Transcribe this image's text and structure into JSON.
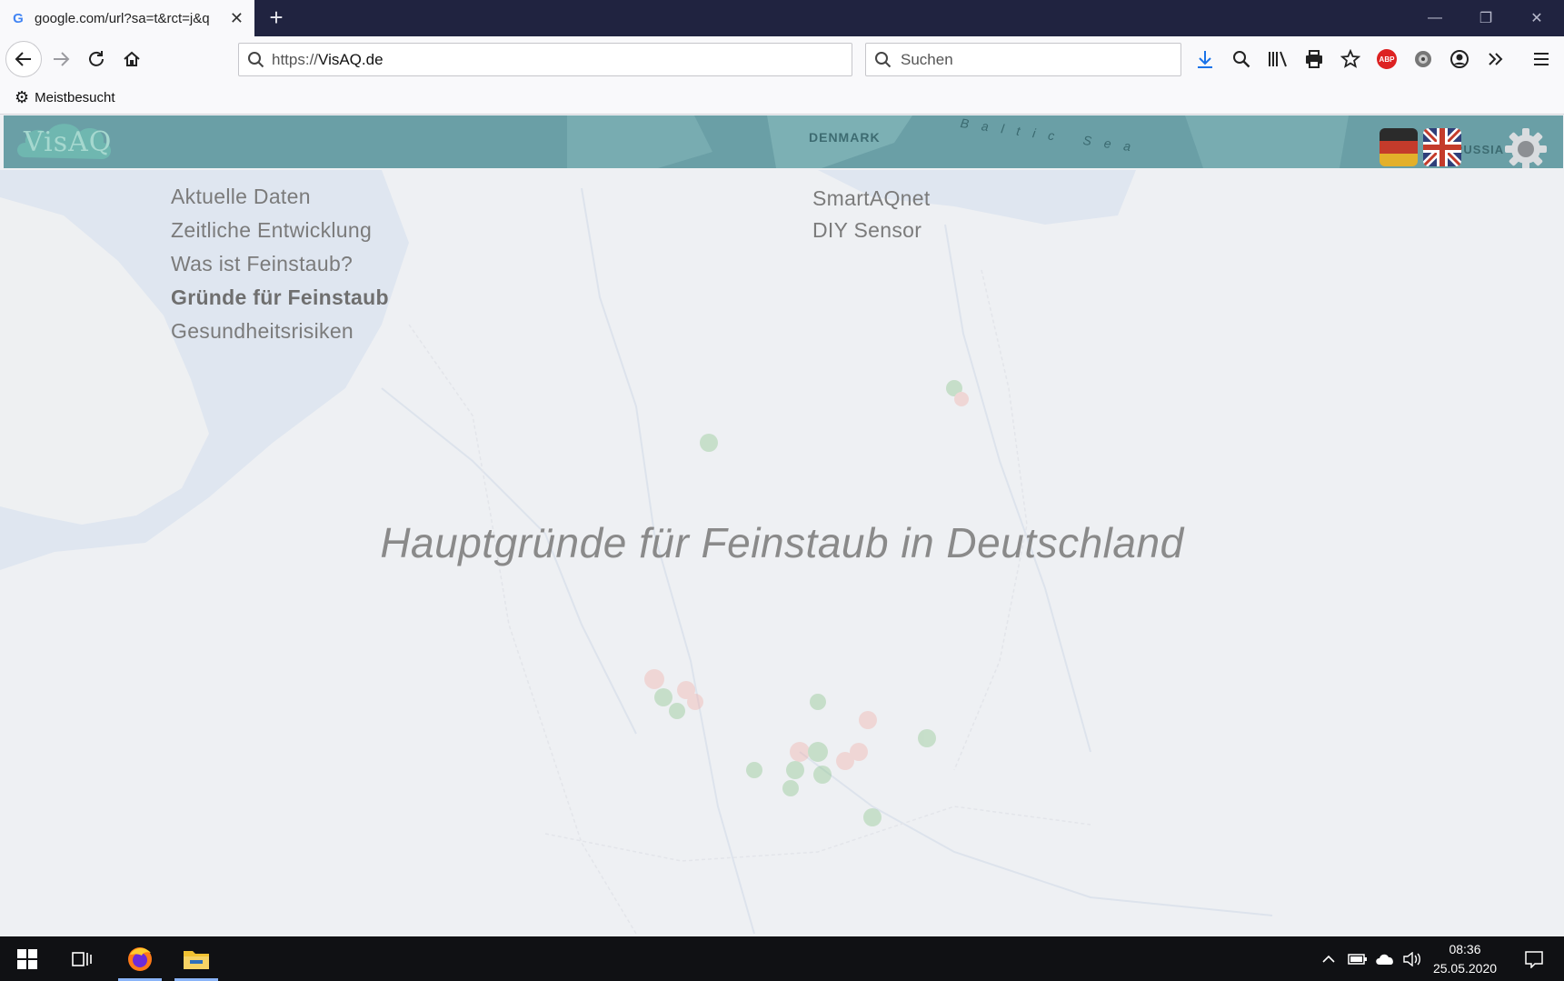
{
  "browser": {
    "tab": {
      "title": "google.com/url?sa=t&rct=j&q",
      "favicon": "G"
    },
    "new_tab_label": "+",
    "url": {
      "prefix": "https://",
      "host": "VisAQ.de"
    },
    "search_placeholder": "Suchen",
    "bookmarks": [
      {
        "label": "Meistbesucht",
        "icon": "gear-icon"
      }
    ]
  },
  "site": {
    "logo_text": "VisAQ",
    "header_labels": [
      "DENMARK",
      "Baltic Sea",
      "RUSSIA"
    ],
    "languages": [
      {
        "code": "de",
        "icon": "german-flag-icon"
      },
      {
        "code": "en",
        "icon": "uk-flag-icon"
      }
    ],
    "menu_left": [
      {
        "label": "Aktuelle Daten",
        "active": false
      },
      {
        "label": "Zeitliche Entwicklung",
        "active": false
      },
      {
        "label": "Was ist Feinstaub?",
        "active": false
      },
      {
        "label": "Gründe für Feinstaub",
        "active": true
      },
      {
        "label": "Gesundheitsrisiken",
        "active": false
      }
    ],
    "menu_right": [
      {
        "label": "SmartAQnet"
      },
      {
        "label": "DIY Sensor"
      }
    ],
    "hero_title": "Hauptgründe für Feinstaub in Deutschland"
  },
  "taskbar": {
    "time": "08:36",
    "date": "25.05.2020"
  },
  "colors": {
    "header_teal": "#6a9fa6",
    "logo_mint": "#a6d8cf",
    "tabbar": "#202340",
    "taskbar": "#101114"
  }
}
